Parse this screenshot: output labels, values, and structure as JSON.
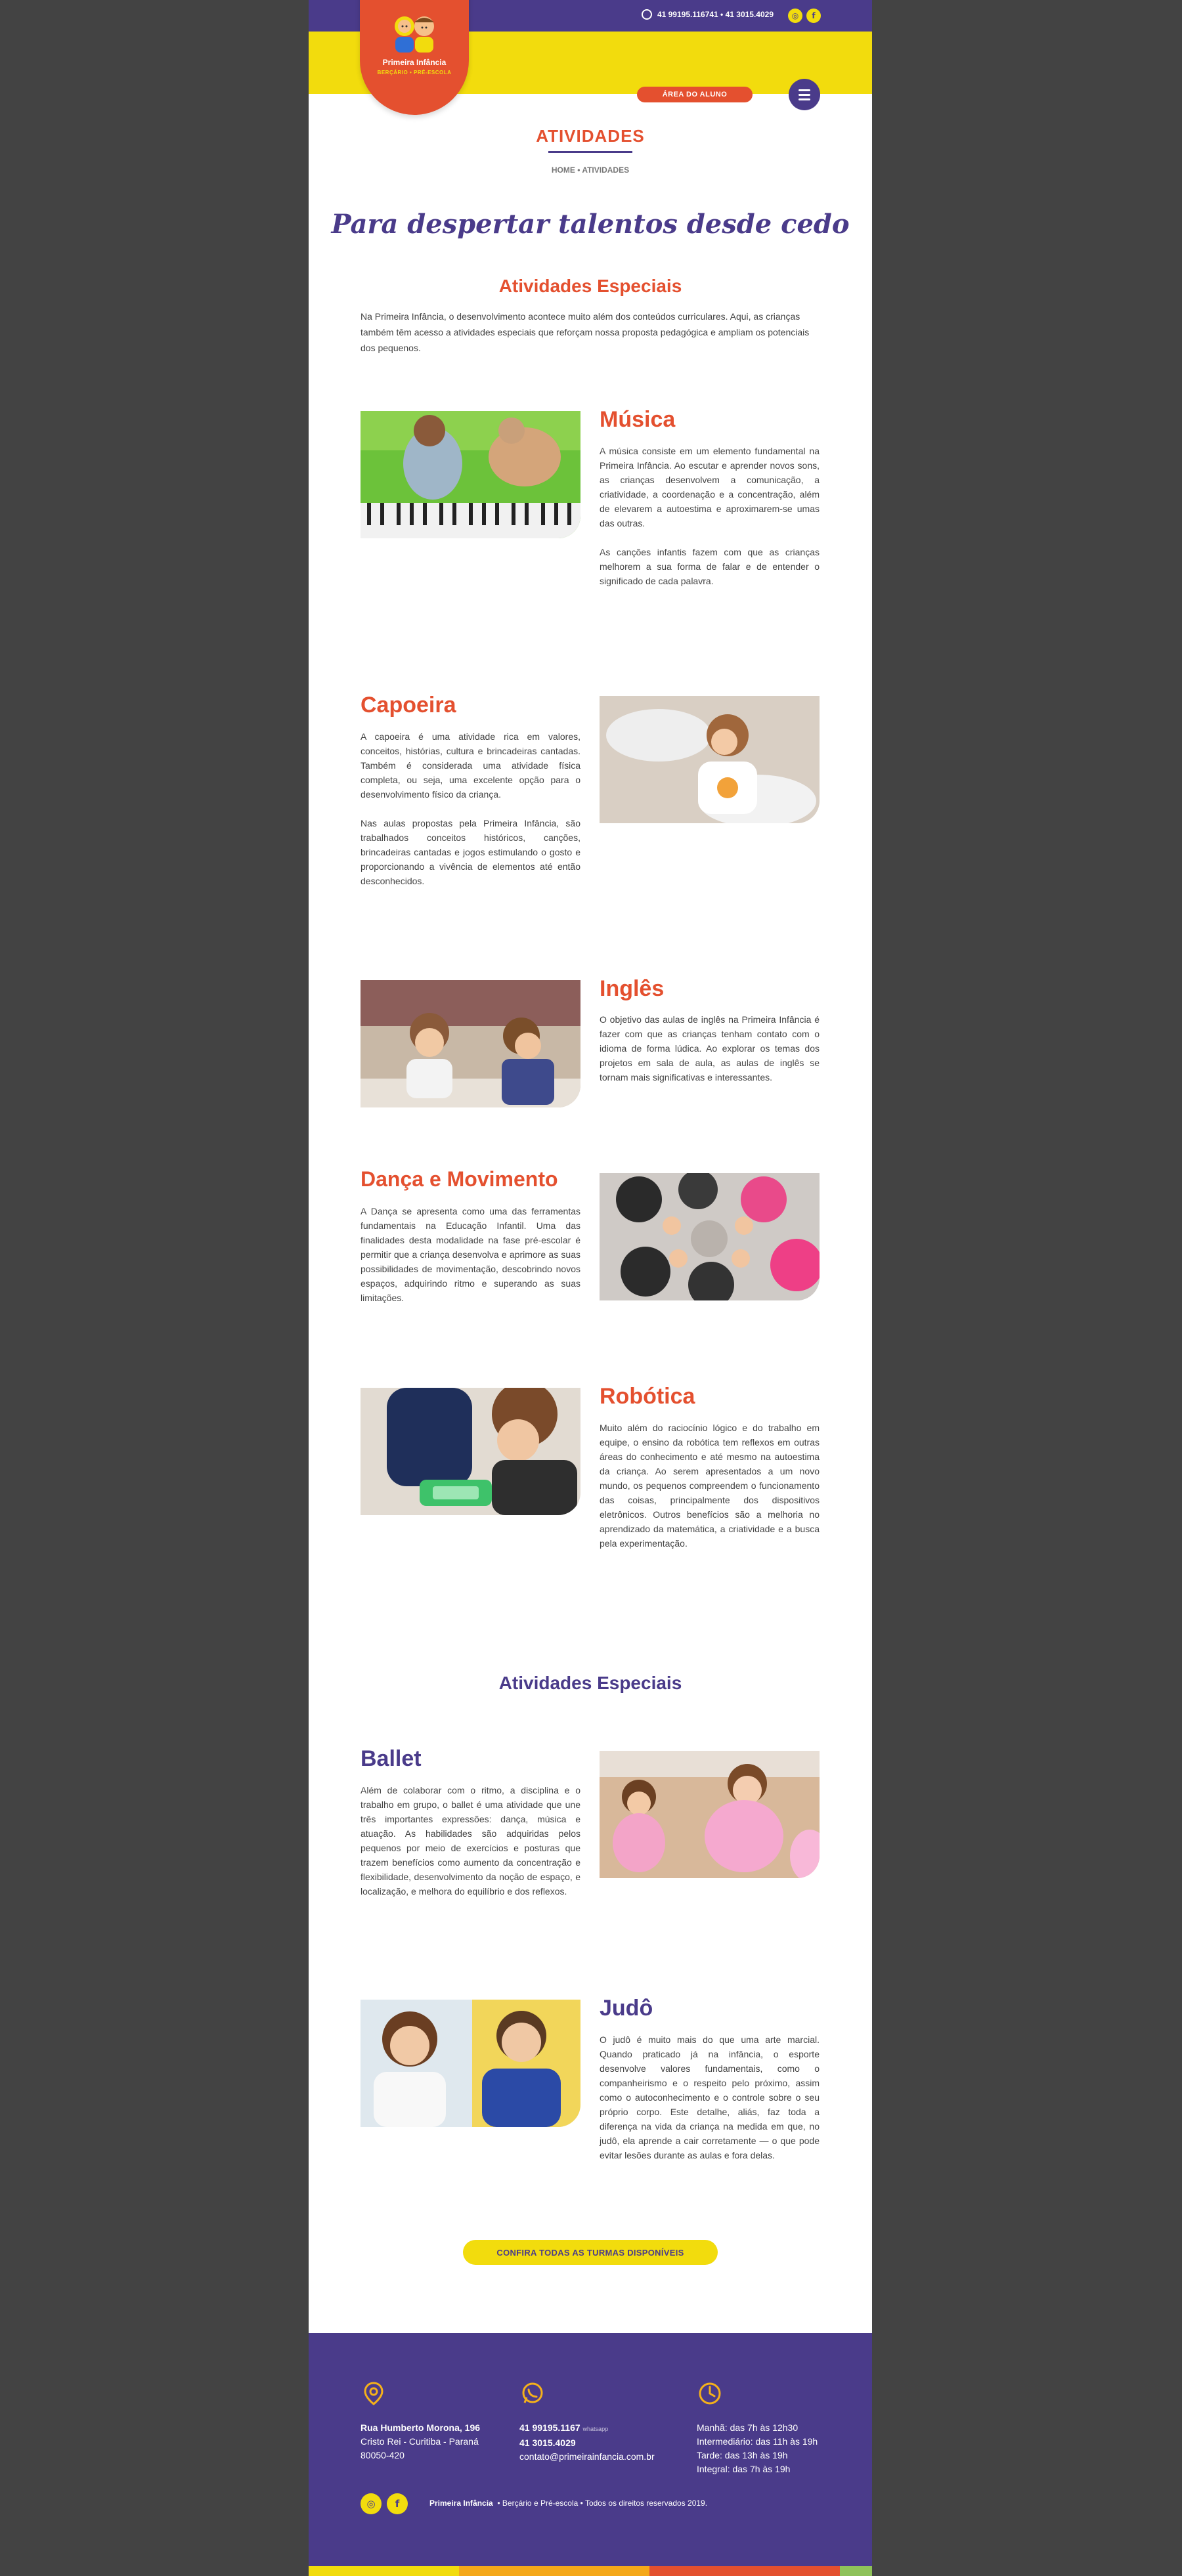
{
  "header": {
    "phones": "41 99195.116741  •  41 3015.4029",
    "social": [
      {
        "icon": "instagram-icon",
        "glyph": "◎"
      },
      {
        "icon": "facebook-icon",
        "glyph": "f"
      }
    ],
    "logo_name": "Primeira Infância",
    "logo_sub": "BERÇÁRIO • PRÉ-ESCOLA",
    "area_button": "ÁREA DO ALUNO"
  },
  "page": {
    "title": "ATIVIDADES",
    "breadcrumb": "HOME • ATIVIDADES",
    "tagline": "Para despertar talentos desde cedo"
  },
  "section1": {
    "heading": "Atividades Especiais",
    "intro": "Na Primeira Infância, o desenvolvimento acontece muito além dos conteúdos curriculares. Aqui, as crianças também têm acesso a atividades especiais que reforçam nossa proposta pedagógica e ampliam os potenciais dos pequenos."
  },
  "activities": [
    {
      "title": "Música",
      "paragraphs": [
        "A música consiste em um elemento fundamental na Primeira Infância. Ao escutar e aprender novos sons, as crianças desenvolvem a comunicação, a criatividade, a coordenação e a concentração, além de elevarem a autoestima e aproximarem-se umas das outras.",
        "As canções infantis fazem com que as crianças melhorem a sua forma de falar e de entender o significado de cada palavra."
      ]
    },
    {
      "title": "Capoeira",
      "paragraphs": [
        "A capoeira é uma atividade rica em valores, conceitos, histórias, cultura e brincadeiras cantadas. Também é considerada uma atividade física completa, ou seja, uma excelente opção para o desenvolvimento físico da criança.",
        "Nas aulas propostas pela Primeira Infância, são trabalhados conceitos históricos, canções, brincadeiras cantadas e jogos estimulando o gosto e proporcionando a vivência de elementos até então desconhecidos."
      ]
    },
    {
      "title": "Inglês",
      "paragraphs": [
        "O objetivo das aulas de inglês na Primeira Infância é fazer com que as crianças tenham contato com o idioma de forma lúdica. Ao explorar os temas dos projetos em sala de aula, as aulas de inglês se tornam mais significativas e interessantes."
      ]
    },
    {
      "title": "Dança e Movimento",
      "paragraphs": [
        "A Dança se apresenta como uma das ferramentas fundamentais na Educação Infantil. Uma das finalidades desta modalidade na fase pré-escolar é permitir que a criança desenvolva e aprimore as suas possibilidades de movimentação, descobrindo novos espaços, adquirindo ritmo e superando as suas limitações."
      ]
    },
    {
      "title": "Robótica",
      "paragraphs": [
        "Muito além do raciocínio lógico e do trabalho em equipe, o ensino da robótica tem reflexos em outras áreas do conhecimento e até mesmo na autoestima da criança. Ao serem apresentados a um novo mundo, os pequenos compreendem o funcionamento das coisas, principalmente dos dispositivos eletrônicos. Outros benefícios são a melhoria no aprendizado da matemática, a criatividade e a busca pela experimentação."
      ]
    }
  ],
  "section2": {
    "heading": "Atividades Especiais"
  },
  "extras": [
    {
      "title": "Ballet",
      "paragraphs": [
        "Além de colaborar com o ritmo, a disciplina e o trabalho em grupo, o ballet é uma atividade que une três importantes expressões: dança, música e atuação. As habilidades são adquiridas pelos pequenos por meio de exercícios e posturas que trazem benefícios como aumento da concentração e flexibilidade, desenvolvimento da noção de espaço, e localização, e melhora do equilíbrio e dos reflexos."
      ]
    },
    {
      "title": "Judô",
      "paragraphs": [
        "O judô é muito mais do que uma arte marcial. Quando praticado já na infância, o esporte desenvolve valores fundamentais, como o companheirismo e o respeito pelo próximo, assim como o autoconhecimento e o controle sobre o seu próprio corpo. Este detalhe, aliás, faz toda a diferença na vida da criança na medida em que, no judô, ela aprende a cair corretamente — o que pode evitar lesões durante as aulas e fora delas."
      ]
    }
  ],
  "cta": "CONFIRA TODAS AS TURMAS DISPONÍVEIS",
  "footer": {
    "address": [
      "Rua Humberto Morona, 196",
      "Cristo Rei  -  Curitiba  -  Paraná",
      "80050-420"
    ],
    "phone1": "41 99195.1167",
    "phone1_tag": "whatsapp",
    "phone2": "41 3015.4029",
    "email": "contato@primeirainfancia.com.br",
    "hours": [
      "Manhã: das 7h às 12h30",
      "Intermediário: das 11h às 19h",
      "Tarde: das 13h às 19h",
      "Integral: das 7h às 19h"
    ],
    "brand": "Primeira Infância",
    "copyright": "•  Berçário e Pré-escola  •  Todos os direitos reservados 2019."
  }
}
